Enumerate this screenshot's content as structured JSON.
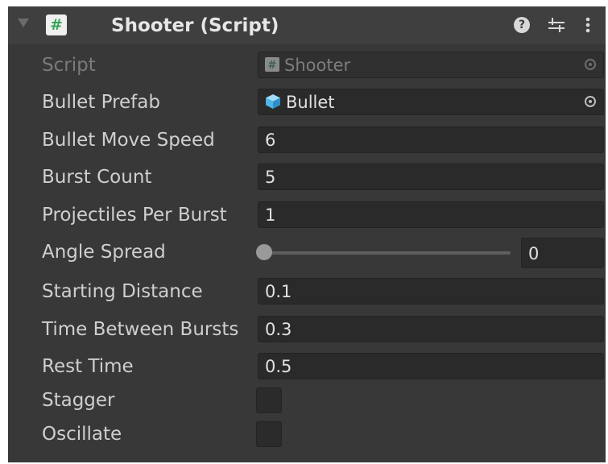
{
  "component": {
    "title": "Shooter (Script)",
    "header_icons": [
      "script-icon",
      "help-icon",
      "presets-icon",
      "menu-icon"
    ],
    "help_glyph": "?"
  },
  "script_field": {
    "label": "Script",
    "value": "Shooter",
    "icon": "script-asset-icon"
  },
  "bullet_prefab": {
    "label": "Bullet Prefab",
    "value": "Bullet",
    "icon": "prefab-cube-icon"
  },
  "fields": [
    {
      "label": "Bullet Move Speed",
      "value": "6"
    },
    {
      "label": "Burst Count",
      "value": "5"
    },
    {
      "label": "Projectiles Per Burst",
      "value": "1"
    }
  ],
  "angle_spread": {
    "label": "Angle Spread",
    "value": "0"
  },
  "fields2": [
    {
      "label": "Starting Distance",
      "value": "0.1"
    },
    {
      "label": "Time Between Bursts",
      "value": "0.3"
    },
    {
      "label": "Rest Time",
      "value": "0.5"
    }
  ],
  "toggles": [
    {
      "label": "Stagger",
      "checked": false
    },
    {
      "label": "Oscillate",
      "checked": false
    }
  ],
  "colors": {
    "panel_bg": "#383838",
    "header_bg": "#3f3f3f",
    "field_bg": "#2a2a2a",
    "label_text": "#cfcfcf",
    "script_icon_green": "#3aa35a",
    "prefab_blue": "#4fb6e8"
  }
}
